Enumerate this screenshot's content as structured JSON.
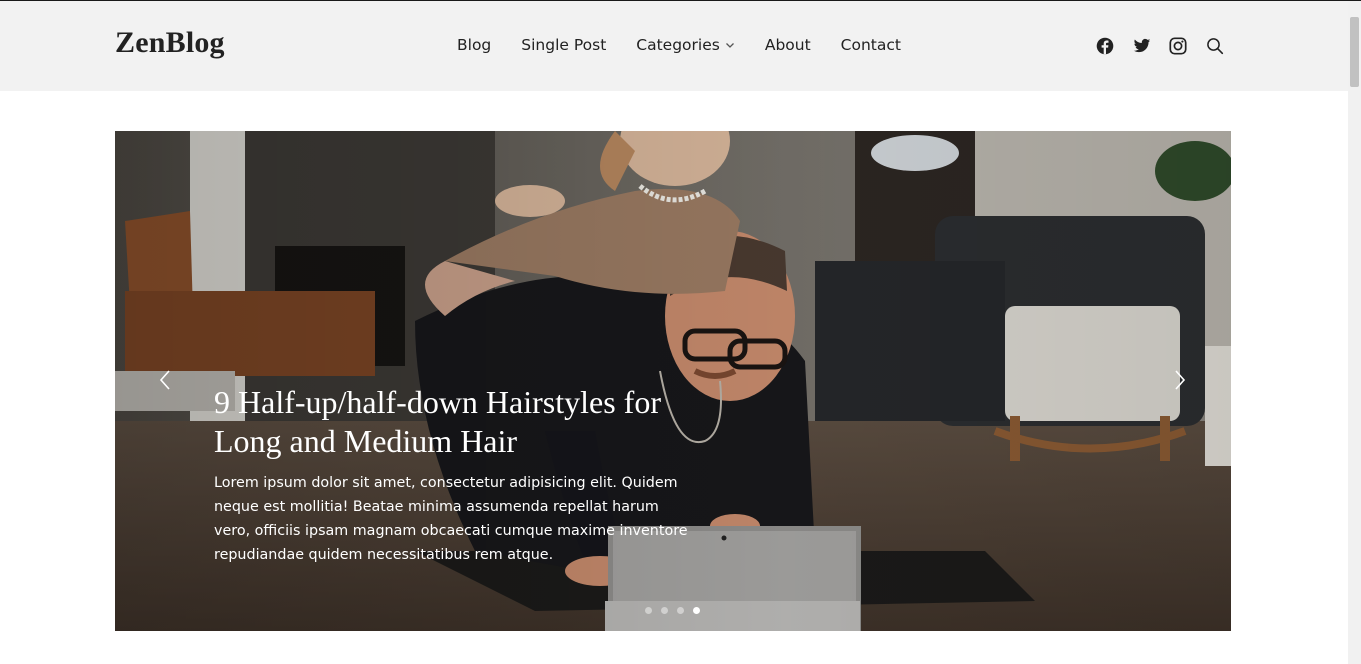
{
  "header": {
    "logo": "ZenBlog",
    "nav": [
      {
        "label": "Blog"
      },
      {
        "label": "Single Post"
      },
      {
        "label": "Categories",
        "has_dropdown": true
      },
      {
        "label": "About"
      },
      {
        "label": "Contact"
      }
    ],
    "social_icons": [
      "facebook-icon",
      "twitter-icon",
      "instagram-icon",
      "search-icon"
    ]
  },
  "hero": {
    "title": "9 Half-up/half-down Hairstyles for Long and Medium Hair",
    "text": "Lorem ipsum dolor sit amet, consectetur adipisicing elit. Quidem neque est mollitia! Beatae minima assumenda repellat harum vero, officiis ipsam magnam obcaecati cumque maxime inventore repudiandae quidem necessitatibus rem atque.",
    "slide_count": 4,
    "active_slide": 4,
    "prev_icon": "chevron-left-icon",
    "next_icon": "chevron-right-icon"
  },
  "colors": {
    "header_bg": "#f2f2f2",
    "text_dark": "#222222",
    "caption_text": "#ffffff"
  }
}
